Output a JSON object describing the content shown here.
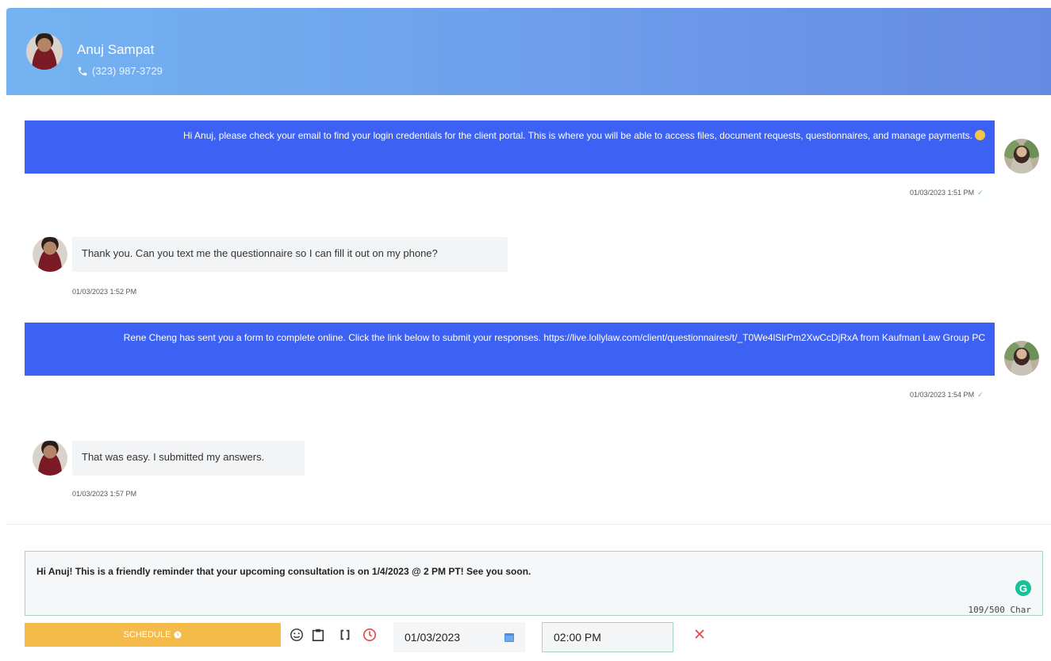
{
  "contact": {
    "name": "Anuj Sampat",
    "phone": "(323) 987-3729"
  },
  "messages": [
    {
      "direction": "outgoing",
      "text": "Hi Anuj, please check your email to find your login credentials for the client portal. This is where you will be able to access files, document requests, questionnaires, and manage payments.",
      "timestamp": "01/03/2023 1:51 PM",
      "status": "delivered"
    },
    {
      "direction": "incoming",
      "text": "Thank you. Can you text me the questionnaire so I can fill it out on my phone?",
      "timestamp": "01/03/2023 1:52 PM"
    },
    {
      "direction": "outgoing",
      "text": "Rene Cheng has sent you a form to complete online. Click the link below to submit your responses. https://live.lollylaw.com/client/questionnaires/t/_T0We4lSlrPm2XwCcDjRxA from Kaufman Law Group PC",
      "timestamp": "01/03/2023 1:54 PM",
      "status": "delivered"
    },
    {
      "direction": "incoming",
      "text": "That was easy. I submitted my answers.",
      "timestamp": "01/03/2023 1:57 PM"
    }
  ],
  "composer": {
    "text": "Hi Anuj! This is a friendly reminder that your upcoming consultation is on 1/4/2023 @ 2 PM PT! See you soon.",
    "char_count": "109/500 Char"
  },
  "schedule": {
    "button_label": "SCHEDULE",
    "date": "01/03/2023",
    "time": "02:00 PM"
  },
  "icons": [
    "phone-icon",
    "emoji-icon",
    "clipboard-icon",
    "brackets-icon",
    "clock-icon",
    "calendar-icon",
    "close-icon",
    "grammarly-icon",
    "check-icon"
  ],
  "colors": {
    "header_start": "#74b3f1",
    "header_end": "#648be2",
    "outgoing_bubble": "#3c61f3",
    "incoming_bubble": "#f3f4f6",
    "schedule_button": "#f4bb4b",
    "accent_red": "#e4444c",
    "composer_border": "#a8d3c4"
  }
}
